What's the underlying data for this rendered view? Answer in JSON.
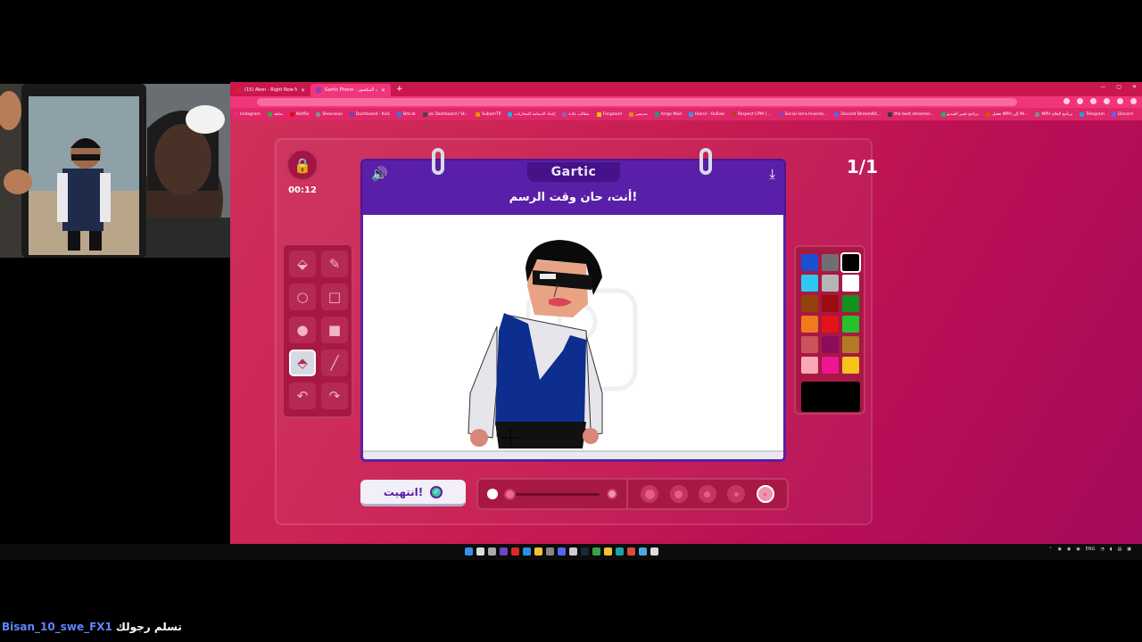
{
  "browser": {
    "tabs": [
      {
        "label": "(15) Akon - Right Now Na Na Na",
        "active": false
      },
      {
        "label": "Gartic Phone - لعبة الهاتف المكسور",
        "active": true
      }
    ],
    "new_tab": "+",
    "bookmarks": [
      "Instagram",
      "شاهد",
      "Netflix",
      "Shoorwan",
      "Dashboard - Kick",
      "Bitrub",
      "ok Dashboard / St...",
      "SubamTP",
      "إعداد الدسامة للمحاربات",
      "مطالب عادة",
      "Fnrgaand",
      "مديسي",
      "Arrge Mad",
      "Hiand - Oullow",
      "Respect CPM | ...",
      "Social ierra Invento...",
      "Discord StreamKit...",
      "the best streamer...",
      "برنامج تغيير الفيديو",
      "تفعيل MPH إلى Mi...",
      "MPH برنامج العلاج",
      "Telegram",
      "Discord"
    ],
    "bookmark_colors": [
      "#e1306c",
      "#3ca34b",
      "#e50914",
      "#8a8a8a",
      "#6b46c1",
      "#2d7be5",
      "#444",
      "#f08c00",
      "#1fb3d3",
      "#9b59b6",
      "#f1c40f",
      "#e67e22",
      "#16a085",
      "#3498db",
      "#c0392b",
      "#8e44ad",
      "#5865f2",
      "#2c3e50",
      "#27ae60",
      "#d35400",
      "#7f8c8d",
      "#229ed9",
      "#5865f2"
    ]
  },
  "game": {
    "timer": "00:12",
    "round": "1/1",
    "logo": "Gartic",
    "prompt": "أنت، حان وقت الرسم!",
    "done_button": "انتهيت!",
    "tools": [
      {
        "name": "eraser",
        "icon": "eraser-icon",
        "glyph": "⬙"
      },
      {
        "name": "pencil",
        "icon": "pencil-icon",
        "glyph": "✎"
      },
      {
        "name": "ellipse-outline",
        "icon": "circle-outline-icon",
        "glyph": "○"
      },
      {
        "name": "rect-outline",
        "icon": "square-outline-icon",
        "glyph": "□"
      },
      {
        "name": "ellipse-fill",
        "icon": "circle-filled-icon",
        "glyph": "●"
      },
      {
        "name": "rect-fill",
        "icon": "square-filled-icon",
        "glyph": "■"
      },
      {
        "name": "fill-bucket",
        "icon": "fill-bucket-icon",
        "glyph": "⬘"
      },
      {
        "name": "line",
        "icon": "line-icon",
        "glyph": "╱"
      },
      {
        "name": "undo",
        "icon": "undo-icon",
        "glyph": "↶"
      },
      {
        "name": "redo",
        "icon": "redo-icon",
        "glyph": "↷"
      }
    ],
    "selected_tool": 6,
    "palette": [
      "#1b4fd0",
      "#6f6f73",
      "#000000",
      "#2cc8f2",
      "#b5b5b8",
      "#ffffff",
      "#93430c",
      "#9a0e12",
      "#13921d",
      "#f07a1c",
      "#e3131a",
      "#27c22a",
      "#c9545d",
      "#8c0b5b",
      "#b07b23",
      "#f7a8b4",
      "#ec1690",
      "#f6c21c"
    ],
    "selected_color": 2,
    "current_color": "#000000",
    "opacity_level": 0.05,
    "sizes": [
      9,
      7,
      5,
      3,
      1
    ],
    "selected_size": 4
  },
  "chat": {
    "user": "Bisan_10_swe_FX1",
    "message": "تسلم رجولك"
  },
  "colors": {
    "accent_purple": "#5a1fa8",
    "panel": "#a81845"
  }
}
